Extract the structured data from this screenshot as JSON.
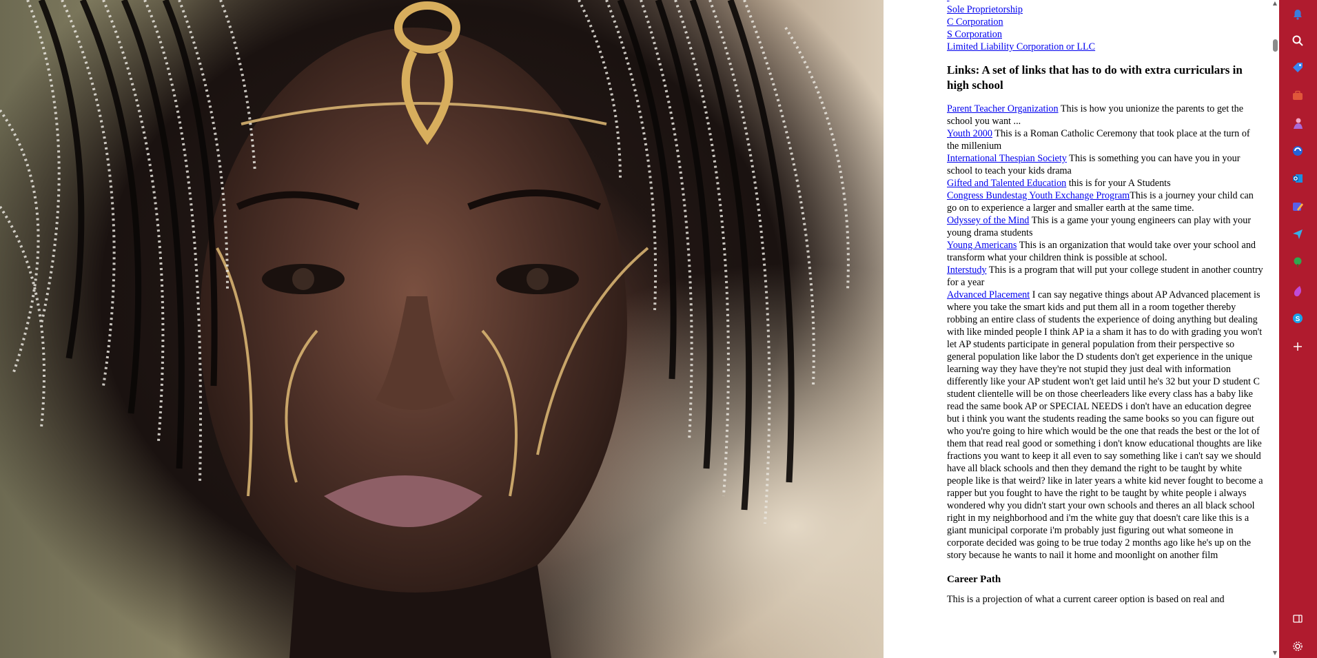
{
  "business_links": [
    "Sole Proprietorship",
    "C Corporation",
    "S Corporation",
    "Limited Liability Corporation or LLC"
  ],
  "extracurricular_heading": "Links: A set of links that has to do with extra curriculars in high school",
  "extracurricular_links": [
    {
      "link": "Parent Teacher Organization",
      "text": " This is how you unionize the parents to get the school you want ..."
    },
    {
      "link": "Youth 2000",
      "text": " This is a Roman Catholic Ceremony that took place at the turn of the millenium"
    },
    {
      "link": "International Thespian Society",
      "text": " This is something you can have you in your school to teach your kids drama"
    },
    {
      "link": "Gifted and Talented Education",
      "text": " this is for your A Students"
    },
    {
      "link": "Congress Bundestag Youth Exchange Program",
      "text": "This is a journey your child can go on to experience a larger and smaller earth at the same time."
    },
    {
      "link": "Odyssey of the Mind",
      "text": " This is a game your young engineers can play with your young drama students"
    },
    {
      "link": "Young Americans",
      "text": " This is an organization that would take over your school and transform what your children think is possible at school."
    },
    {
      "link": "Interstudy",
      "text": " This is a program that will put your college student in another country for a year"
    },
    {
      "link": "Advanced Placement",
      "text": " I can say negative things about AP Advanced placement is where you take the smart kids and put them all in a room together thereby robbing an entire class of students the experience of doing anything but dealing with like minded people I think AP ia a sham it has to do with grading you won't let AP students participate in general population from their perspective so general population like labor the D students don't get experience in the unique learning way they have they're not stupid they just deal with information differently like your AP student won't get laid until he's 32 but your D student C student clientelle will be on those cheerleaders like every class has a baby like read the same book AP or SPECIAL NEEDS i don't have an education degree but i think you want the students reading the same books so you can figure out who you're going to hire which would be the one that reads the best or the lot of them that read real good or something i don't know educational thoughts are like fractions you want to keep it all even to say something like i can't say we should have all black schools and then they demand the right to be taught by white people like is that weird? like in later years a white kid never fought to become a rapper but you fought to have the right to be taught by white people i always wondered why you didn't start your own schools and theres an all black school right in my neighborhood and i'm the white guy that doesn't care like this is a giant municipal corporate i'm probably just figuring out what someone in corporate decided was going to be true today 2 months ago like he's up on the story because he wants to nail it home and moonlight on another film"
    }
  ],
  "career_heading": "Career Path",
  "career_intro": "This is a projection of what a current career option is based on real and",
  "sidebar_icons": [
    "bell-icon",
    "search-icon",
    "tag-icon",
    "briefcase-icon",
    "games-icon",
    "copilot-icon",
    "outlook-icon",
    "designer-icon",
    "send-icon",
    "tree-icon",
    "drop-icon",
    "skype-icon",
    "add-icon",
    "split-screen-icon",
    "settings-icon"
  ],
  "colors": {
    "sidebar_bg": "#b01b2e",
    "link": "#0000ee"
  }
}
